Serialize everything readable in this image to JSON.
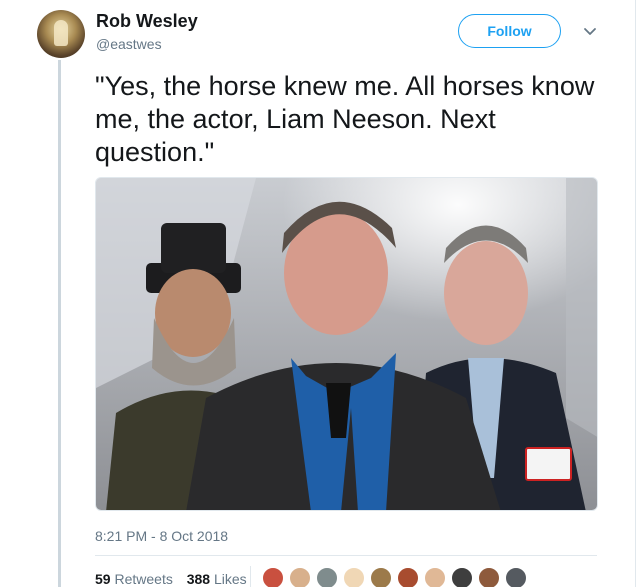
{
  "author": {
    "name": "Rob Wesley",
    "handle": "@eastwes"
  },
  "actions": {
    "follow_label": "Follow"
  },
  "tweet": {
    "text": "\"Yes, the horse knew me. All horses know me, the actor, Liam Neeson. Next question.\"",
    "timestamp": "8:21 PM - 8 Oct 2018"
  },
  "stats": {
    "retweets_count": "59",
    "retweets_label": "Retweets",
    "likes_count": "388",
    "likes_label": "Likes"
  },
  "icons": {
    "caret": "chevron-down-icon"
  },
  "colors": {
    "accent": "#1da1f2",
    "text_primary": "#14171a",
    "text_secondary": "#657786",
    "border": "#e1e8ed"
  },
  "likers": [
    {
      "color": "#c9503f"
    },
    {
      "color": "#d8b08c"
    },
    {
      "color": "#7f8c8d"
    },
    {
      "color": "#f0d7b5"
    },
    {
      "color": "#9c7a4a"
    },
    {
      "color": "#a84c2f"
    },
    {
      "color": "#e0b896"
    },
    {
      "color": "#3e3e3e"
    },
    {
      "color": "#8e5a3c"
    },
    {
      "color": "#555a60"
    }
  ]
}
